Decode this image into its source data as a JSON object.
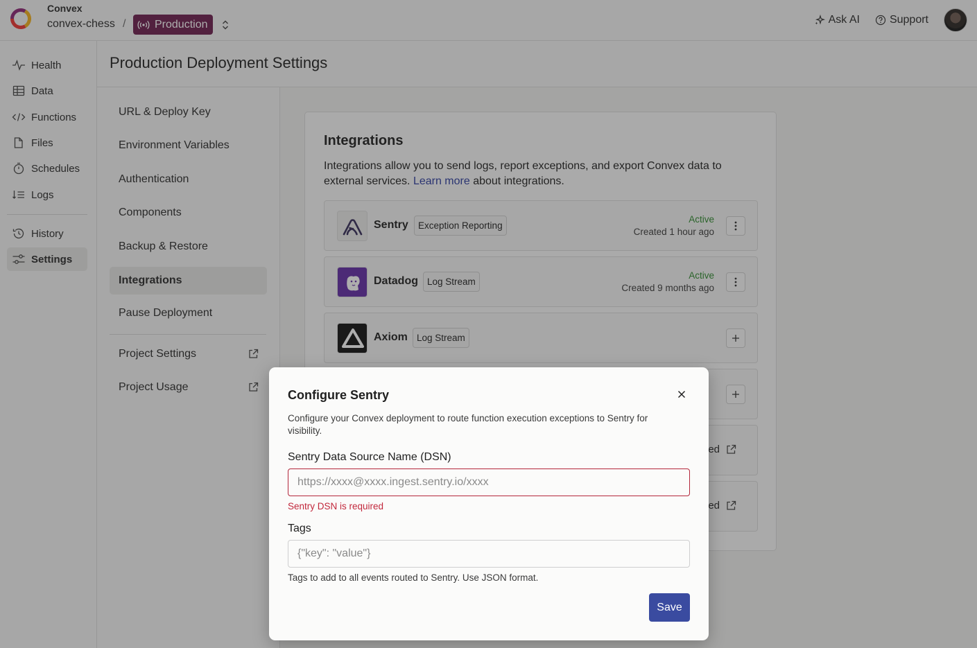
{
  "topbar": {
    "org_name": "Convex",
    "project_name": "convex-chess",
    "separator": "/",
    "environment": "Production",
    "ask_ai": "Ask AI",
    "support": "Support"
  },
  "nav": {
    "items": [
      {
        "label": "Health",
        "icon": "pulse-icon"
      },
      {
        "label": "Data",
        "icon": "table-icon"
      },
      {
        "label": "Functions",
        "icon": "code-icon"
      },
      {
        "label": "Files",
        "icon": "file-icon"
      },
      {
        "label": "Schedules",
        "icon": "stopwatch-icon"
      },
      {
        "label": "Logs",
        "icon": "logs-icon"
      },
      {
        "label": "History",
        "icon": "history-icon"
      },
      {
        "label": "Settings",
        "icon": "sliders-icon"
      }
    ],
    "active": "Settings"
  },
  "page": {
    "title": "Production Deployment Settings"
  },
  "settings_nav": {
    "items": [
      {
        "label": "URL & Deploy Key"
      },
      {
        "label": "Environment Variables"
      },
      {
        "label": "Authentication"
      },
      {
        "label": "Components"
      },
      {
        "label": "Backup & Restore"
      },
      {
        "label": "Integrations"
      },
      {
        "label": "Pause Deployment"
      },
      {
        "label": "Project Settings"
      },
      {
        "label": "Project Usage"
      }
    ],
    "active": "Integrations"
  },
  "integrations": {
    "title": "Integrations",
    "desc_before": "Integrations allow you to send logs, report exceptions, and export Convex data to external services. ",
    "learn_more": "Learn more",
    "desc_after": " about integrations.",
    "items": [
      {
        "name": "Sentry",
        "tag": "Exception Reporting",
        "status": "Active",
        "created": "Created 1 hour ago"
      },
      {
        "name": "Datadog",
        "tag": "Log Stream",
        "status": "Active",
        "created": "Created 9 months ago"
      },
      {
        "name": "Axiom",
        "tag": "Log Stream"
      }
    ],
    "partial_link_1": "ed",
    "partial_link_2": "ed"
  },
  "modal": {
    "title": "Configure Sentry",
    "description": "Configure your Convex deployment to route function execution exceptions to Sentry for visibility.",
    "dsn_label": "Sentry Data Source Name (DSN)",
    "dsn_value": "",
    "dsn_placeholder": "https://xxxx@xxxx.ingest.sentry.io/xxxx",
    "dsn_error": "Sentry DSN is required",
    "tags_label": "Tags",
    "tags_value": "",
    "tags_placeholder": "{\"key\": \"value\"}",
    "tags_help": "Tags to add to all events routed to Sentry. Use JSON format.",
    "save_label": "Save"
  },
  "colors": {
    "production_badge": "#6d1e4e",
    "primary_button": "#3a4ba0",
    "active_status": "#2e8a2e",
    "error": "#c2283c",
    "link": "#2c3da0"
  }
}
